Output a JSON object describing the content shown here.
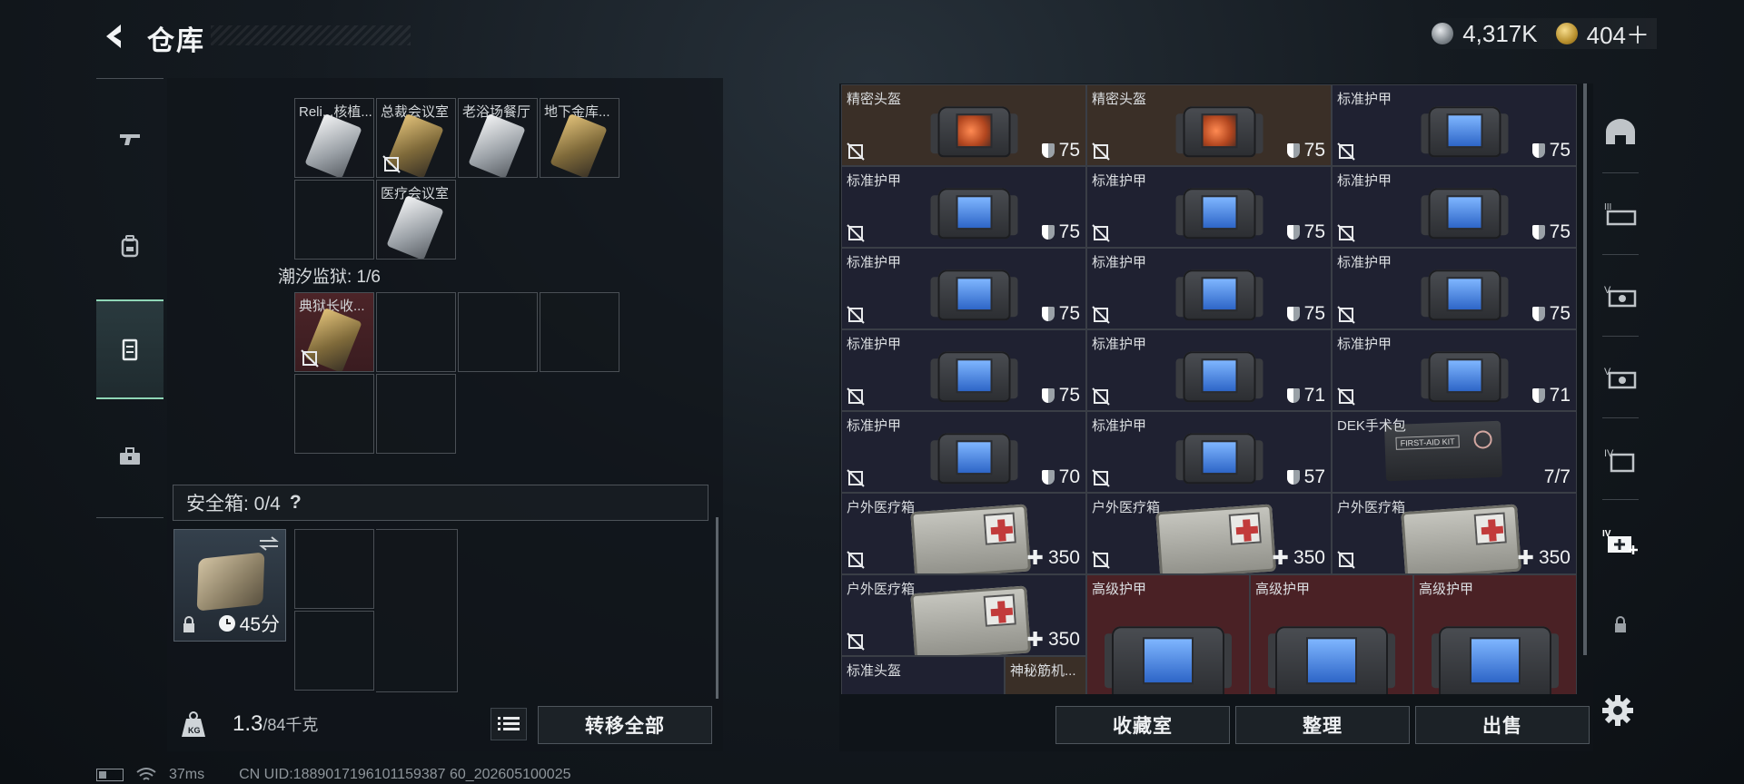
{
  "header": {
    "title": "仓库",
    "currency_silver": "4,317K",
    "currency_gold": "404＋"
  },
  "left_sidebar": {
    "items": [
      {
        "name": "weapon",
        "icon": "pistol-icon"
      },
      {
        "name": "gear",
        "icon": "backpack-icon"
      },
      {
        "name": "storage",
        "icon": "locker-icon",
        "active": true
      },
      {
        "name": "tools",
        "icon": "toolbox-icon"
      }
    ]
  },
  "left_panel": {
    "top_group_cards": [
      {
        "label": "Reli...核植...",
        "color": "brown",
        "card": "silver",
        "nodrop": false
      },
      {
        "label": "总裁会议室",
        "color": "red",
        "card": "gold",
        "nodrop": true
      },
      {
        "label": "老浴场餐厅",
        "color": "navy",
        "card": "silver",
        "nodrop": false
      },
      {
        "label": "地下金库...",
        "color": "red",
        "card": "gold",
        "nodrop": false
      },
      {
        "label": "医疗会议室",
        "color": "brown",
        "card": "silver",
        "nodrop": false
      }
    ],
    "tide_prison_label": "潮汐监狱: 1/6",
    "tide_prison_cards": [
      {
        "label": "典狱长收...",
        "color": "red",
        "card": "gold",
        "nodrop": true
      }
    ],
    "safebox_label": "安全箱: 0/4",
    "safebox_help": "?",
    "safebox_item_time": "45分",
    "weight_current": "1.3",
    "weight_max": "/84千克",
    "transfer_all": "转移全部"
  },
  "inventory": {
    "rows": [
      [
        {
          "name": "精密头盔",
          "kind": "helmet",
          "color": "brown",
          "value": "75",
          "val_icon": "shield",
          "nodrop": true
        },
        {
          "name": "精密头盔",
          "kind": "helmet",
          "color": "brown",
          "value": "75",
          "val_icon": "shield",
          "nodrop": true
        },
        {
          "name": "标准护甲",
          "kind": "vest",
          "color": "navy",
          "value": "75",
          "val_icon": "shield",
          "nodrop": true
        }
      ],
      [
        {
          "name": "标准护甲",
          "kind": "vest",
          "color": "navy",
          "value": "75",
          "val_icon": "shield",
          "nodrop": true
        },
        {
          "name": "标准护甲",
          "kind": "vest",
          "color": "navy",
          "value": "75",
          "val_icon": "shield",
          "nodrop": true
        },
        {
          "name": "标准护甲",
          "kind": "vest",
          "color": "navy",
          "value": "75",
          "val_icon": "shield",
          "nodrop": true
        }
      ],
      [
        {
          "name": "标准护甲",
          "kind": "vest",
          "color": "navy",
          "value": "75",
          "val_icon": "shield",
          "nodrop": true
        },
        {
          "name": "标准护甲",
          "kind": "vest",
          "color": "navy",
          "value": "75",
          "val_icon": "shield",
          "nodrop": true
        },
        {
          "name": "标准护甲",
          "kind": "vest",
          "color": "navy",
          "value": "75",
          "val_icon": "shield",
          "nodrop": true
        }
      ],
      [
        {
          "name": "标准护甲",
          "kind": "vest",
          "color": "navy",
          "value": "75",
          "val_icon": "shield",
          "nodrop": true
        },
        {
          "name": "标准护甲",
          "kind": "vest",
          "color": "navy",
          "value": "71",
          "val_icon": "shield",
          "nodrop": true
        },
        {
          "name": "标准护甲",
          "kind": "vest",
          "color": "navy",
          "value": "71",
          "val_icon": "shield",
          "nodrop": true
        }
      ],
      [
        {
          "name": "标准护甲",
          "kind": "vest",
          "color": "navy",
          "value": "70",
          "val_icon": "shield",
          "nodrop": true
        },
        {
          "name": "标准护甲",
          "kind": "vest",
          "color": "navy",
          "value": "57",
          "val_icon": "shield",
          "nodrop": true
        },
        {
          "name": "DEK手术包",
          "kind": "dek",
          "color": "navy",
          "value": "7/7",
          "val_icon": "none",
          "nodrop": false,
          "bag_text": "FIRST-AID KIT"
        }
      ],
      [
        {
          "name": "户外医疗箱",
          "kind": "med",
          "color": "navy",
          "value": "350",
          "val_icon": "plus",
          "nodrop": true
        },
        {
          "name": "户外医疗箱",
          "kind": "med",
          "color": "navy",
          "value": "350",
          "val_icon": "plus",
          "nodrop": true
        },
        {
          "name": "户外医疗箱",
          "kind": "med",
          "color": "navy",
          "value": "350",
          "val_icon": "plus",
          "nodrop": true
        }
      ]
    ],
    "row7": [
      {
        "name": "户外医疗箱",
        "value": "350"
      },
      {
        "name": "高级护甲"
      },
      {
        "name": "高级护甲"
      },
      {
        "name": "高级护甲"
      }
    ],
    "row8": [
      {
        "name": "标准头盔"
      },
      {
        "name": "神秘筋机..."
      }
    ]
  },
  "bottom_buttons": {
    "collection": "收藏室",
    "organize": "整理",
    "sell": "出售"
  },
  "status_bar": {
    "ping": "37ms",
    "uid": "CN UID:1889017196101159387 60_202605100025"
  }
}
